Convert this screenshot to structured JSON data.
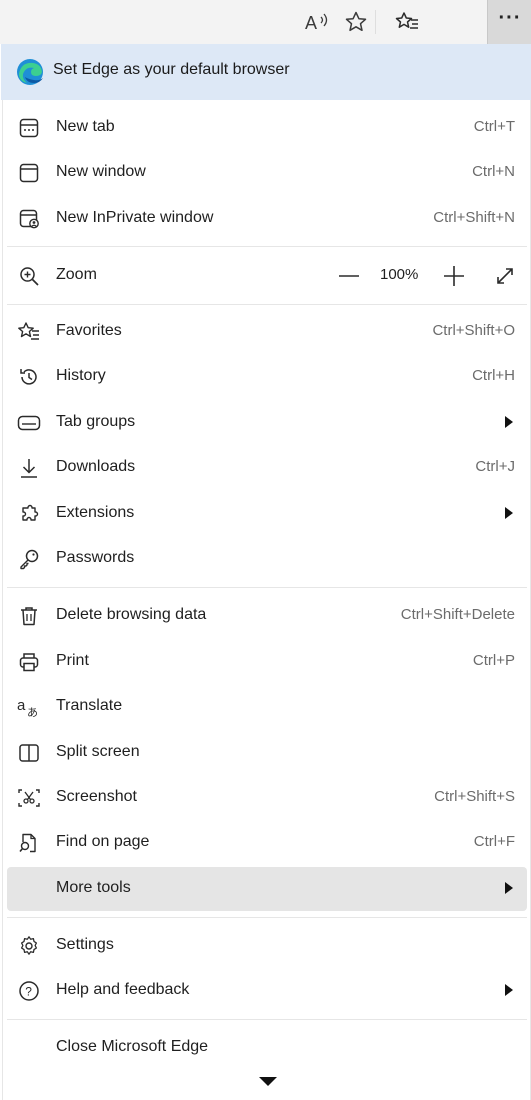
{
  "toolbar": {
    "read_aloud_label": "A",
    "more_label": "···"
  },
  "banner": {
    "text": "Set Edge as your default browser"
  },
  "items": [
    {
      "label": "New tab",
      "shortcut": "Ctrl+T"
    },
    {
      "label": "New window",
      "shortcut": "Ctrl+N"
    },
    {
      "label": "New InPrivate window",
      "shortcut": "Ctrl+Shift+N"
    },
    {
      "label": "Zoom",
      "shortcut": ""
    },
    {
      "label": "Favorites",
      "shortcut": "Ctrl+Shift+O"
    },
    {
      "label": "History",
      "shortcut": "Ctrl+H"
    },
    {
      "label": "Tab groups",
      "shortcut": ""
    },
    {
      "label": "Downloads",
      "shortcut": "Ctrl+J"
    },
    {
      "label": "Extensions",
      "shortcut": ""
    },
    {
      "label": "Passwords",
      "shortcut": ""
    },
    {
      "label": "Delete browsing data",
      "shortcut": "Ctrl+Shift+Delete"
    },
    {
      "label": "Print",
      "shortcut": "Ctrl+P"
    },
    {
      "label": "Translate",
      "shortcut": ""
    },
    {
      "label": "Split screen",
      "shortcut": ""
    },
    {
      "label": "Screenshot",
      "shortcut": "Ctrl+Shift+S"
    },
    {
      "label": "Find on page",
      "shortcut": "Ctrl+F"
    },
    {
      "label": "More tools",
      "shortcut": ""
    },
    {
      "label": "Settings",
      "shortcut": ""
    },
    {
      "label": "Help and feedback",
      "shortcut": ""
    },
    {
      "label": "Close Microsoft Edge",
      "shortcut": ""
    }
  ],
  "zoom": {
    "value": "100%",
    "minus": "—",
    "plus": "+"
  },
  "icons": {
    "read_aloud": "read-aloud-icon",
    "favorite_star": "star-icon",
    "favorites_list": "favorites-icon",
    "more": "more-icon",
    "edge_logo": "edge-logo-icon",
    "new_tab": "new-tab-icon",
    "new_window": "new-window-icon",
    "inprivate": "inprivate-icon",
    "zoom": "zoom-icon",
    "history": "history-icon",
    "tab_groups": "tab-groups-icon",
    "downloads": "download-icon",
    "extensions": "puzzle-icon",
    "passwords": "key-icon",
    "delete": "trash-icon",
    "print": "printer-icon",
    "translate": "translate-icon",
    "split_screen": "split-screen-icon",
    "screenshot": "screenshot-icon",
    "find": "find-icon",
    "settings": "gear-icon",
    "help": "help-icon",
    "fullscreen": "fullscreen-icon",
    "submenu": "chevron-right-icon",
    "scroll_down": "chevron-down-icon"
  },
  "colors": {
    "banner_bg": "#dde8f6",
    "highlight_bg": "#e5e5e5",
    "toolbar_bg": "#f3f3f3"
  }
}
